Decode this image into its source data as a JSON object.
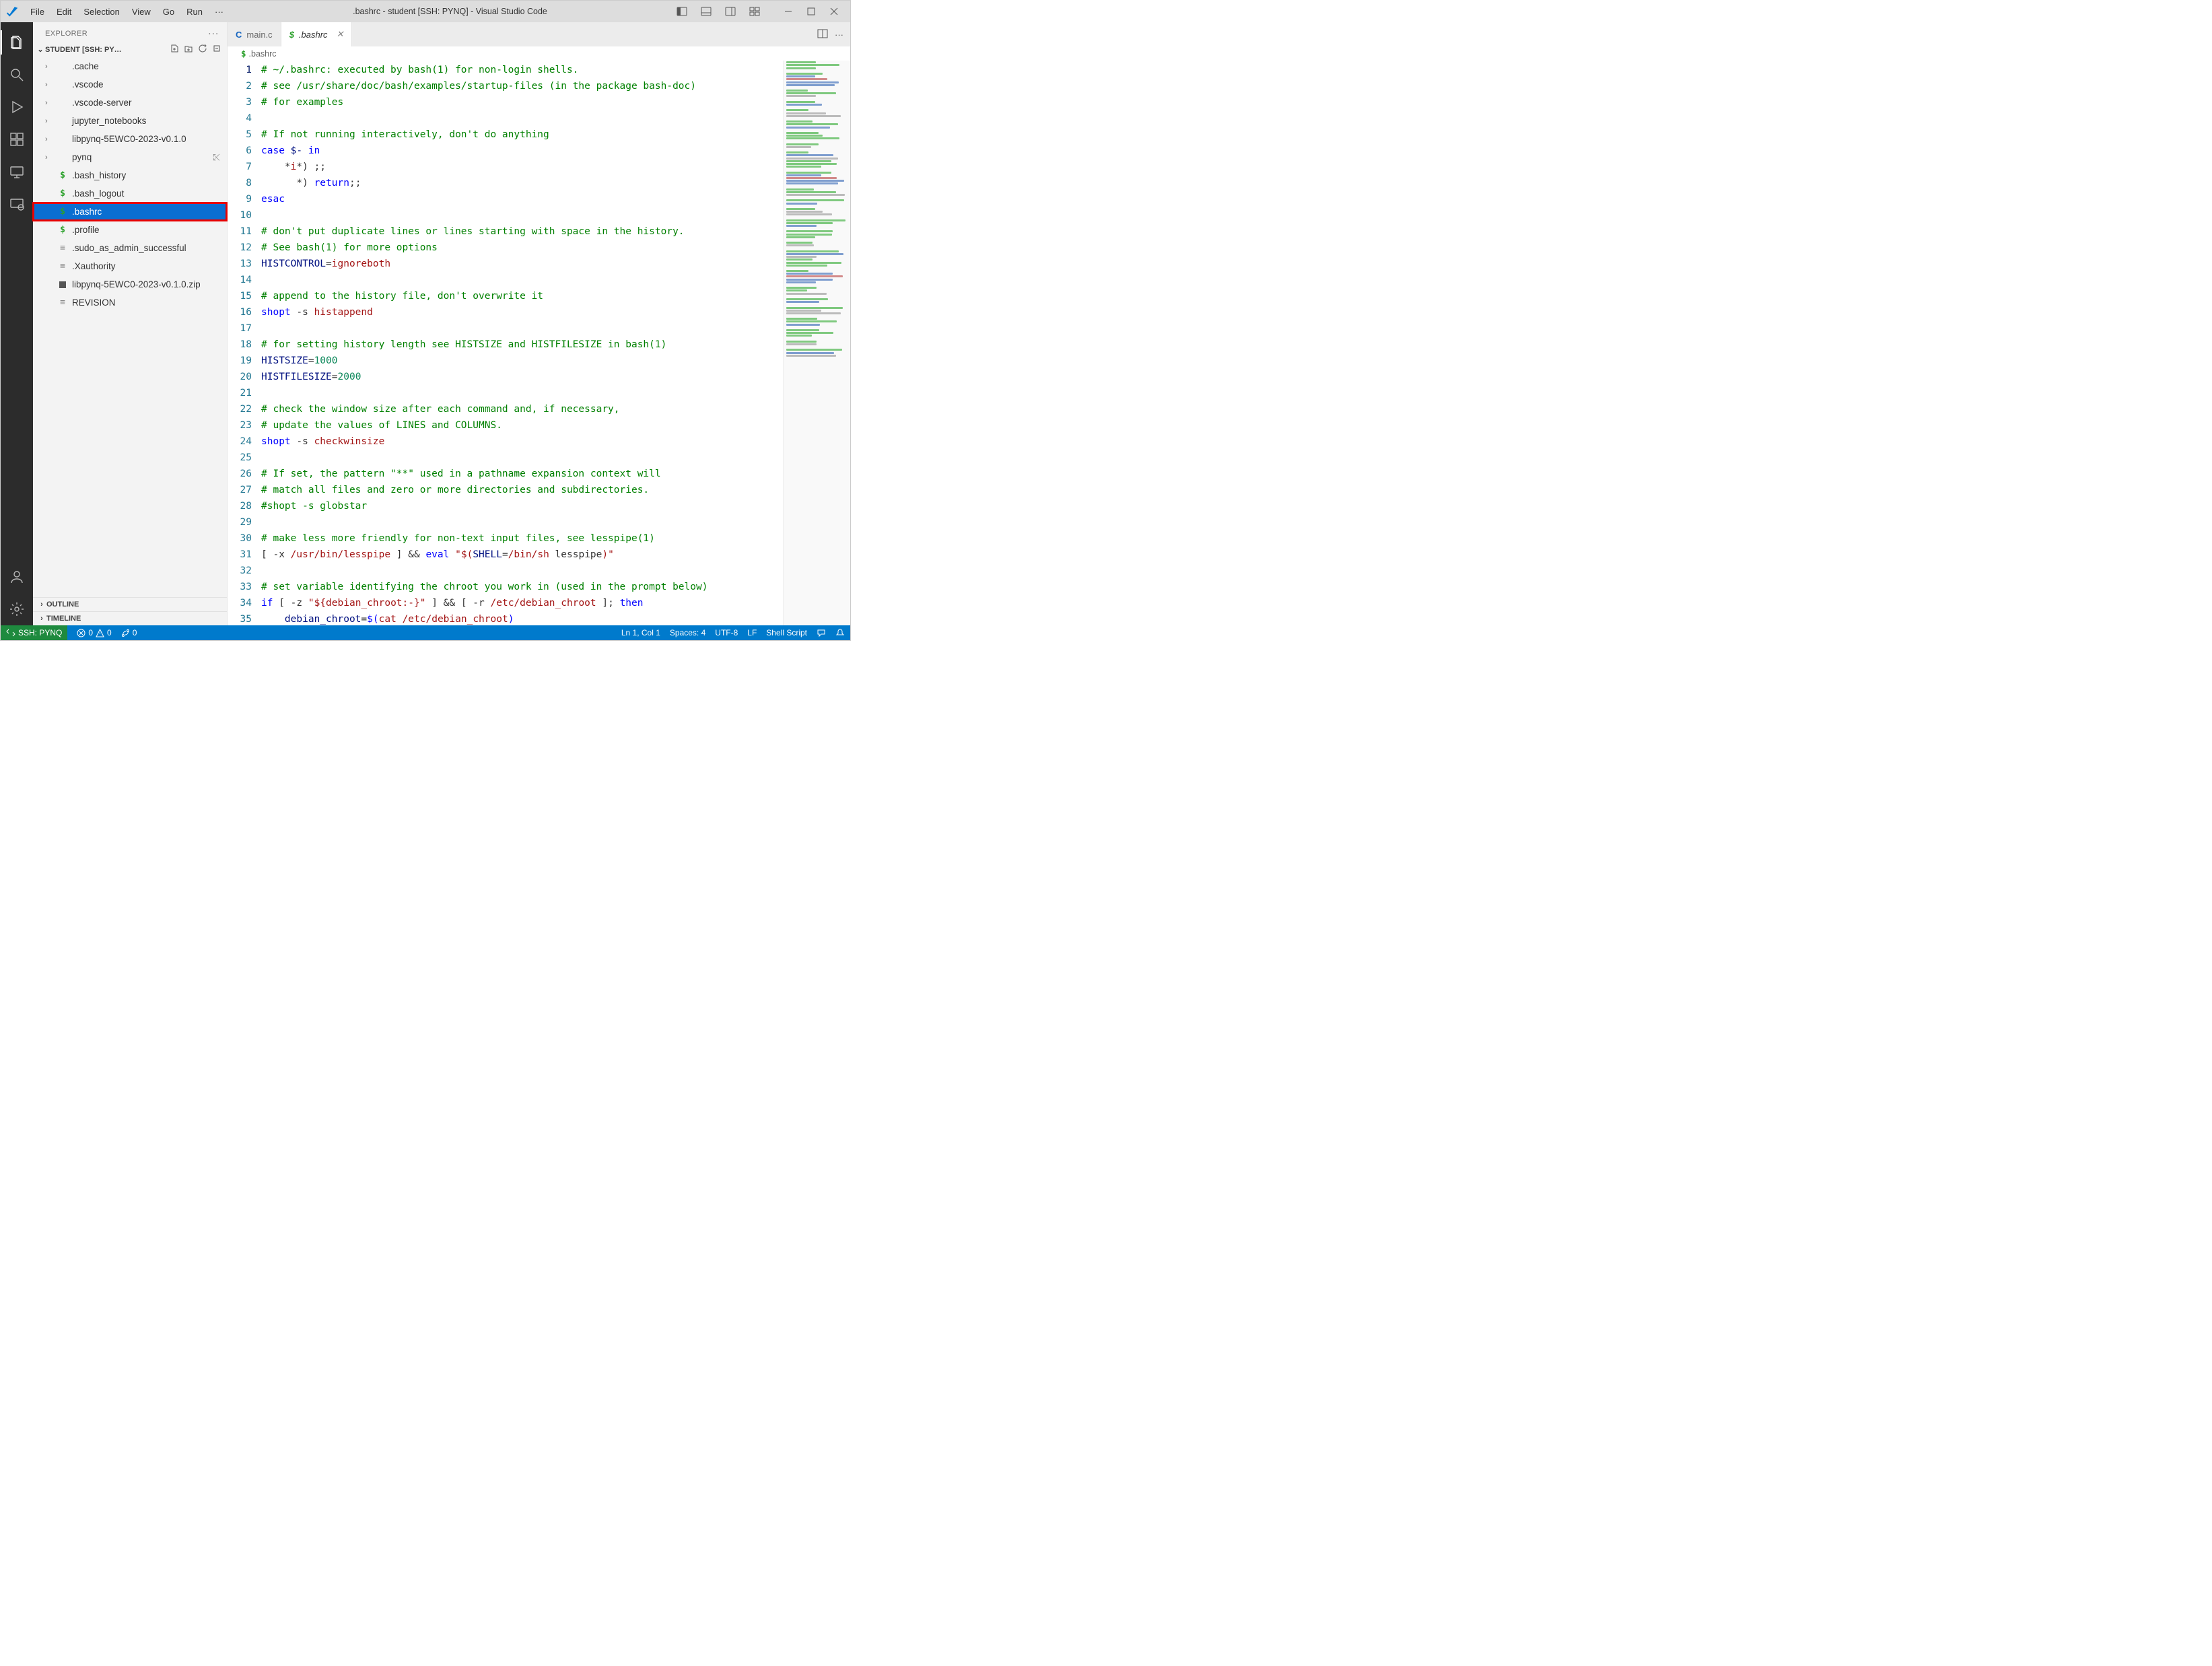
{
  "titlebar": {
    "menu": [
      "File",
      "Edit",
      "Selection",
      "View",
      "Go",
      "Run"
    ],
    "menu_ellipsis": "···",
    "title": ".bashrc - student [SSH: PYNQ] - Visual Studio Code"
  },
  "activitybar": {
    "items": [
      {
        "name": "explorer-icon",
        "active": true
      },
      {
        "name": "search-icon",
        "active": false
      },
      {
        "name": "run-debug-icon",
        "active": false
      },
      {
        "name": "extensions-icon",
        "active": false
      },
      {
        "name": "remote-explorer-icon",
        "active": false
      },
      {
        "name": "remote-settings-icon",
        "active": false
      }
    ],
    "bottom": [
      {
        "name": "accounts-icon"
      },
      {
        "name": "manage-gear-icon"
      }
    ]
  },
  "sidebar": {
    "header": {
      "title": "EXPLORER",
      "dots": "···"
    },
    "section": {
      "label": "STUDENT [SSH: PY…"
    },
    "tree": [
      {
        "type": "folder",
        "label": ".cache"
      },
      {
        "type": "folder",
        "label": ".vscode"
      },
      {
        "type": "folder",
        "label": ".vscode-server"
      },
      {
        "type": "folder",
        "label": "jupyter_notebooks"
      },
      {
        "type": "folder",
        "label": "libpynq-5EWC0-2023-v0.1.0"
      },
      {
        "type": "folder",
        "label": "pynq",
        "hover": true
      },
      {
        "type": "sh",
        "label": ".bash_history"
      },
      {
        "type": "sh",
        "label": ".bash_logout"
      },
      {
        "type": "sh",
        "label": ".bashrc",
        "selected": true,
        "highlighted": true
      },
      {
        "type": "sh",
        "label": ".profile"
      },
      {
        "type": "txt",
        "label": ".sudo_as_admin_successful"
      },
      {
        "type": "txt",
        "label": ".Xauthority"
      },
      {
        "type": "zip",
        "label": "libpynq-5EWC0-2023-v0.1.0.zip"
      },
      {
        "type": "txt",
        "label": "REVISION"
      }
    ],
    "bottom_sections": [
      "OUTLINE",
      "TIMELINE"
    ]
  },
  "tabs": [
    {
      "icon": "c",
      "label": "main.c",
      "active": false,
      "closable": false
    },
    {
      "icon": "sh",
      "label": ".bashrc",
      "active": true,
      "closable": true
    }
  ],
  "breadcrumb": {
    "icon": "$",
    "label": ".bashrc"
  },
  "code": {
    "line_count": 35,
    "lines": [
      [
        [
          "cmt",
          "# ~/.bashrc: executed by bash(1) for non-login shells."
        ]
      ],
      [
        [
          "cmt",
          "# see /usr/share/doc/bash/examples/startup-files (in the package bash-doc)"
        ]
      ],
      [
        [
          "cmt",
          "# for examples"
        ]
      ],
      [],
      [
        [
          "cmt",
          "# If not running interactively, don't do anything"
        ]
      ],
      [
        [
          "kw",
          "case "
        ],
        [
          "var",
          "$-"
        ],
        [
          "kw",
          " in"
        ]
      ],
      [
        [
          "op",
          "    *"
        ],
        [
          "str",
          "i"
        ],
        [
          "op",
          "*) ;;"
        ]
      ],
      [
        [
          "op",
          "      *) "
        ],
        [
          "kw",
          "return"
        ],
        [
          "op",
          ";;"
        ]
      ],
      [
        [
          "kw",
          "esac"
        ]
      ],
      [],
      [
        [
          "cmt",
          "# don't put duplicate lines or lines starting with space in the history."
        ]
      ],
      [
        [
          "cmt",
          "# See bash(1) for more options"
        ]
      ],
      [
        [
          "var",
          "HISTCONTROL"
        ],
        [
          "op",
          "="
        ],
        [
          "str",
          "ignoreboth"
        ]
      ],
      [],
      [
        [
          "cmt",
          "# append to the history file, don't overwrite it"
        ]
      ],
      [
        [
          "kw",
          "shopt"
        ],
        [
          "op",
          " -s "
        ],
        [
          "str",
          "histappend"
        ]
      ],
      [],
      [
        [
          "cmt",
          "# for setting history length see HISTSIZE and HISTFILESIZE in bash(1)"
        ]
      ],
      [
        [
          "var",
          "HISTSIZE"
        ],
        [
          "op",
          "="
        ],
        [
          "num",
          "1000"
        ]
      ],
      [
        [
          "var",
          "HISTFILESIZE"
        ],
        [
          "op",
          "="
        ],
        [
          "num",
          "2000"
        ]
      ],
      [],
      [
        [
          "cmt",
          "# check the window size after each command and, if necessary,"
        ]
      ],
      [
        [
          "cmt",
          "# update the values of LINES and COLUMNS."
        ]
      ],
      [
        [
          "kw",
          "shopt"
        ],
        [
          "op",
          " -s "
        ],
        [
          "str",
          "checkwinsize"
        ]
      ],
      [],
      [
        [
          "cmt",
          "# If set, the pattern \"**\" used in a pathname expansion context will"
        ]
      ],
      [
        [
          "cmt",
          "# match all files and zero or more directories and subdirectories."
        ]
      ],
      [
        [
          "cmt",
          "#shopt -s globstar"
        ]
      ],
      [],
      [
        [
          "cmt",
          "# make less more friendly for non-text input files, see lesspipe(1)"
        ]
      ],
      [
        [
          "op",
          "[ -x "
        ],
        [
          "str",
          "/usr/bin/lesspipe"
        ],
        [
          "op",
          " ] && "
        ],
        [
          "kw",
          "eval"
        ],
        [
          "op",
          " "
        ],
        [
          "str",
          "\"$("
        ],
        [
          "var",
          "SHELL"
        ],
        [
          "op",
          "="
        ],
        [
          "str",
          "/bin/sh"
        ],
        [
          "op",
          " lesspipe"
        ],
        [
          "str",
          ")\""
        ]
      ],
      [],
      [
        [
          "cmt",
          "# set variable identifying the chroot you work in (used in the prompt below)"
        ]
      ],
      [
        [
          "kw",
          "if"
        ],
        [
          "op",
          " [ -z "
        ],
        [
          "str",
          "\"${debian_chroot:-}\""
        ],
        [
          "op",
          " ] && [ -r "
        ],
        [
          "str",
          "/etc/debian_chroot"
        ],
        [
          "op",
          " ]; "
        ],
        [
          "kw",
          "then"
        ]
      ],
      [
        [
          "op",
          "    "
        ],
        [
          "var",
          "debian_chroot"
        ],
        [
          "op",
          "="
        ],
        [
          "kw",
          "$("
        ],
        [
          "str",
          "cat"
        ],
        [
          "op",
          " "
        ],
        [
          "str",
          "/etc/debian_chroot"
        ],
        [
          "kw",
          ")"
        ]
      ]
    ]
  },
  "statusbar": {
    "remote": "SSH: PYNQ",
    "errors": "0",
    "warnings": "0",
    "ports": "0",
    "lncol": "Ln 1, Col 1",
    "spaces": "Spaces: 4",
    "encoding": "UTF-8",
    "eol": "LF",
    "lang": "Shell Script"
  }
}
